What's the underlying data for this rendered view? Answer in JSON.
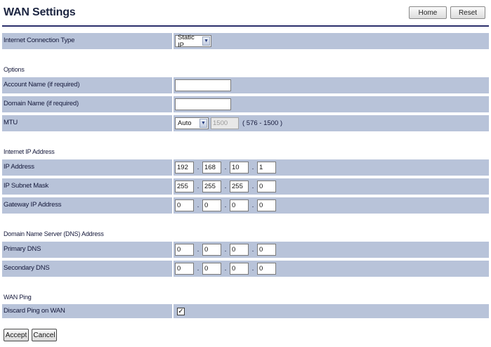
{
  "page": {
    "title": "WAN Settings"
  },
  "header_buttons": {
    "home": "Home",
    "reset": "Reset"
  },
  "connection": {
    "label": "Internet Connection Type",
    "value": "Static IP"
  },
  "options": {
    "section": "Options",
    "account_label": "Account Name (if required)",
    "account_value": "",
    "domain_label": "Domain Name (if required)",
    "domain_value": "",
    "mtu_label": "MTU",
    "mtu_mode": "Auto",
    "mtu_value": "1500",
    "mtu_range": "( 576 - 1500 )"
  },
  "ip": {
    "section": "Internet IP Address",
    "address_label": "IP Address",
    "address": [
      "192",
      "168",
      "10",
      "1"
    ],
    "mask_label": "IP Subnet Mask",
    "mask": [
      "255",
      "255",
      "255",
      "0"
    ],
    "gateway_label": "Gateway IP Address",
    "gateway": [
      "0",
      "0",
      "0",
      "0"
    ]
  },
  "dns": {
    "section": "Domain Name Server (DNS) Address",
    "primary_label": "Primary DNS",
    "primary": [
      "0",
      "0",
      "0",
      "0"
    ],
    "secondary_label": "Secondary DNS",
    "secondary": [
      "0",
      "0",
      "0",
      "0"
    ]
  },
  "ping": {
    "section": "WAN Ping",
    "label": "Discard Ping on WAN",
    "checked": true
  },
  "actions": {
    "accept": "Accept",
    "cancel": "Cancel"
  },
  "colors": {
    "row_bg": "#b8c3d9",
    "title": "#1b2440"
  }
}
